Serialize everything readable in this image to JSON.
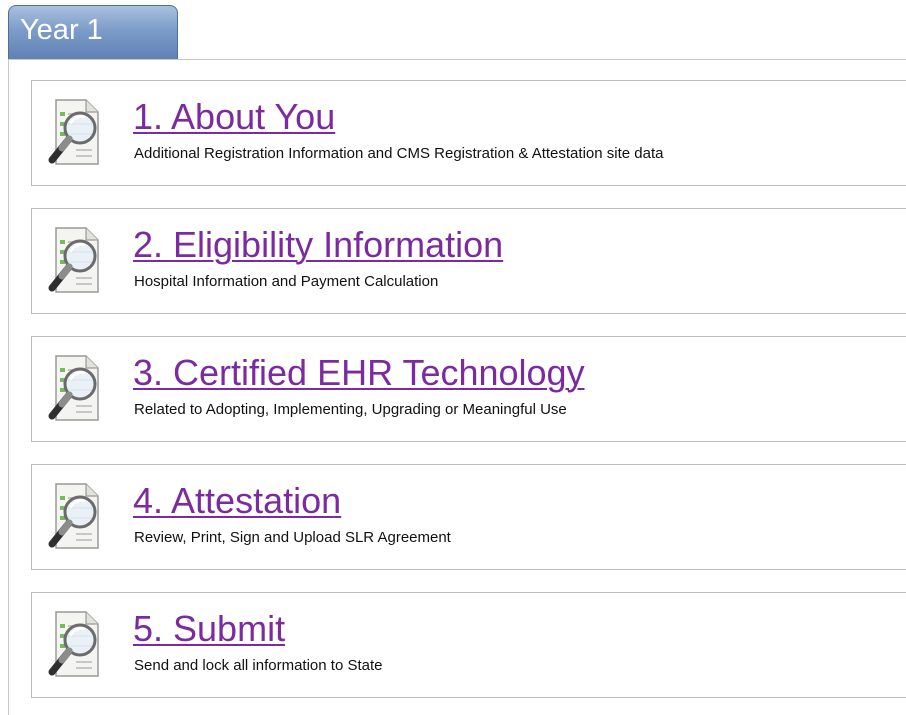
{
  "tab": {
    "label": "Year 1"
  },
  "steps": [
    {
      "title": "1. About You",
      "description": "Additional Registration Information and CMS Registration & Attestation site data"
    },
    {
      "title": "2. Eligibility Information",
      "description": "Hospital Information and Payment Calculation"
    },
    {
      "title": "3. Certified EHR Technology",
      "description": "Related to Adopting, Implementing, Upgrading or Meaningful Use"
    },
    {
      "title": "4. Attestation",
      "description": "Review, Print, Sign and Upload SLR Agreement"
    },
    {
      "title": "5. Submit",
      "description": "Send and lock all information to State"
    }
  ],
  "icons": {
    "step": "document-magnifier-icon"
  },
  "colors": {
    "link": "#7b2aa0",
    "tab_top": "#a9c1e0",
    "tab_bottom": "#5f82b4",
    "border": "#bdbdbd"
  }
}
